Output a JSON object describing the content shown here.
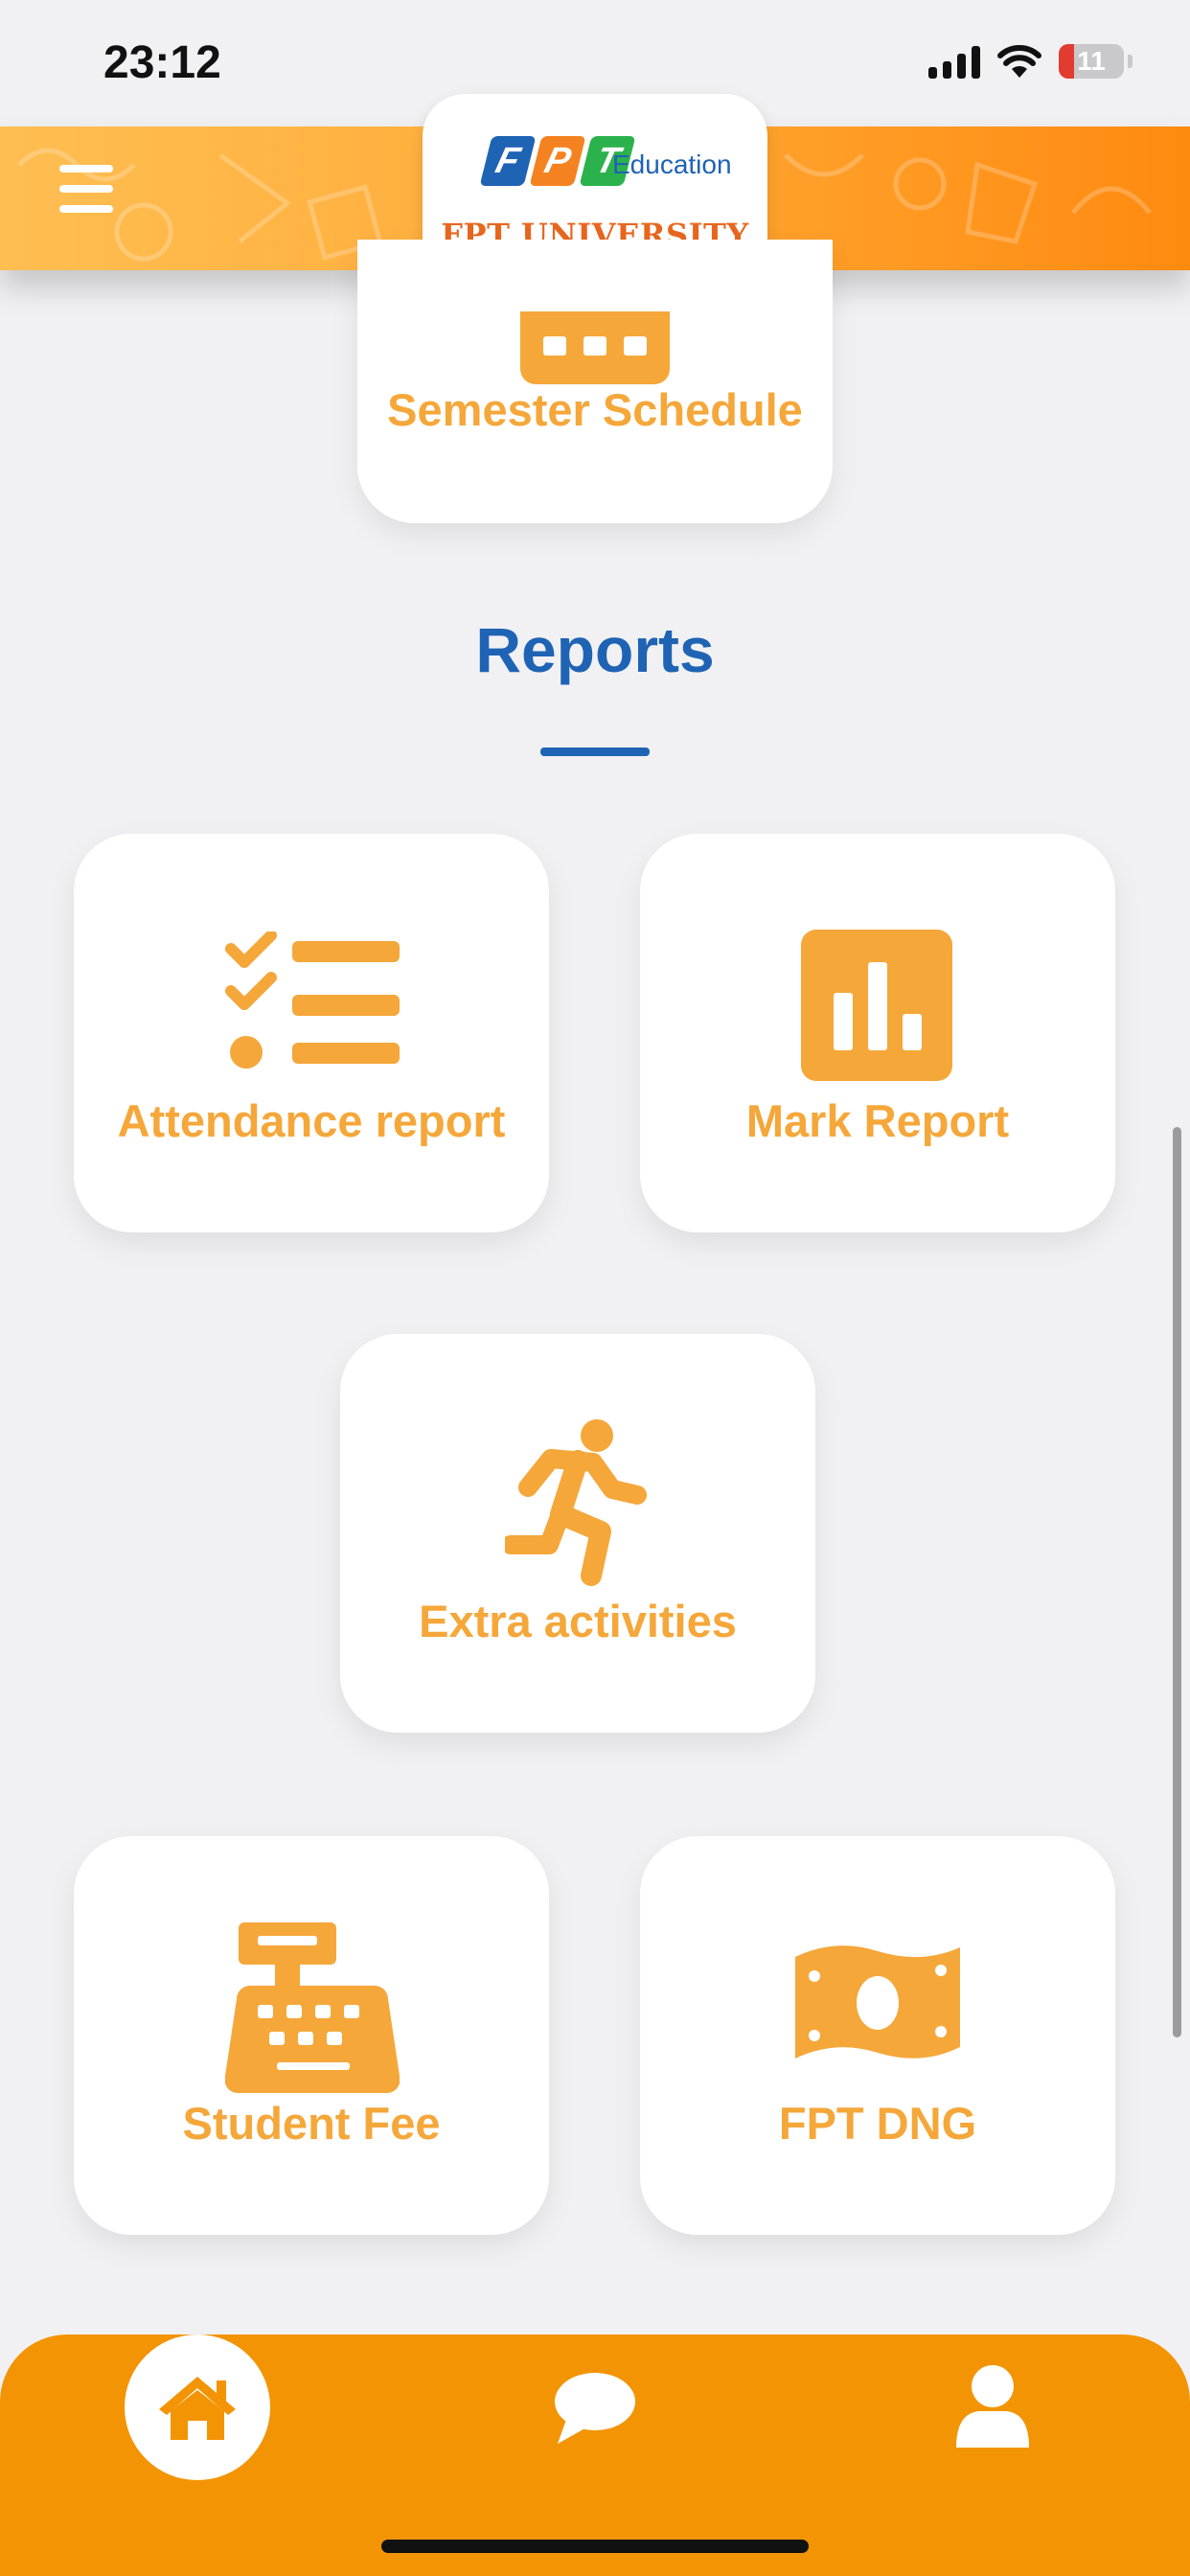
{
  "status_bar": {
    "time": "23:12",
    "battery": "11"
  },
  "header": {
    "logo_letters": [
      "F",
      "P",
      "T"
    ],
    "logo_subtitle": "Education",
    "logo_title": "FPT UNIVERSITY"
  },
  "top_card": {
    "label": "Semester Schedule",
    "icon": "calendar-icon"
  },
  "reports": {
    "title": "Reports",
    "cards": [
      {
        "label": "Attendance report",
        "icon": "checklist-icon"
      },
      {
        "label": "Mark Report",
        "icon": "bar-chart-icon"
      },
      {
        "label": "Extra activities",
        "icon": "running-person-icon"
      },
      {
        "label": "Student Fee",
        "icon": "cash-register-icon"
      },
      {
        "label": "FPT DNG",
        "icon": "banknote-icon"
      }
    ]
  },
  "bottom_nav": {
    "items": [
      "home-icon",
      "chat-icon",
      "user-icon"
    ]
  },
  "colors": {
    "accent": "#f5a73a",
    "nav_orange": "#f39405",
    "title_blue": "#1f63b4",
    "background": "#f1f1f3"
  }
}
